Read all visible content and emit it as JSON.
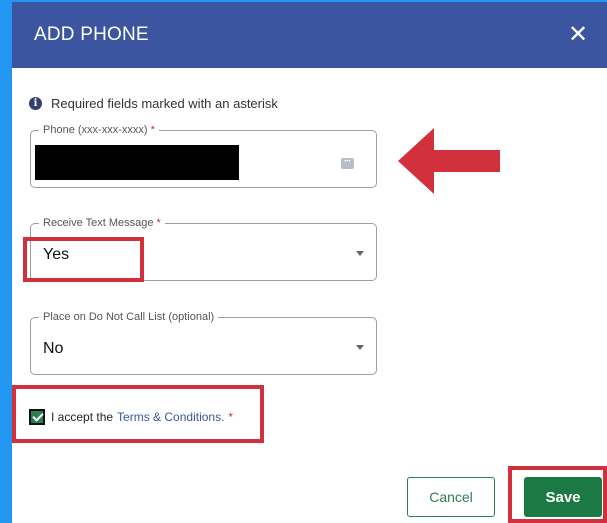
{
  "dialog": {
    "title": "ADD PHONE",
    "close_symbol": "✕"
  },
  "notice": {
    "icon": "info-icon",
    "text": "Required fields marked with an asterisk"
  },
  "phone_field": {
    "label": "Phone (xxx-xxx-xxxx)",
    "required_mark": "*",
    "value_redacted": true
  },
  "text_message_field": {
    "label": "Receive Text Message",
    "required_mark": "*",
    "value": "Yes"
  },
  "do_not_call_field": {
    "label": "Place on Do Not Call List (optional)",
    "value": "No"
  },
  "terms": {
    "checked": true,
    "prefix": "I accept the",
    "link": "Terms & Conditions.",
    "required_mark": "*"
  },
  "buttons": {
    "cancel": "Cancel",
    "save": "Save"
  },
  "colors": {
    "header": "#3b55a0",
    "primary_green": "#1b7a43",
    "annotation_red": "#d0313c",
    "background_blue": "#1e88e5"
  }
}
